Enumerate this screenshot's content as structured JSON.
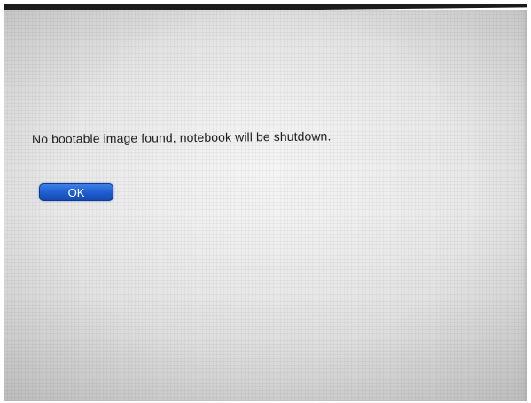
{
  "dialog": {
    "message": "No bootable image found, notebook will be shutdown.",
    "ok_label": "OK"
  },
  "colors": {
    "button_blue": "#1f5fd0",
    "screen_background": "#e6e6e6",
    "text": "#1c1c1c",
    "bezel": "#1b1b1b"
  }
}
